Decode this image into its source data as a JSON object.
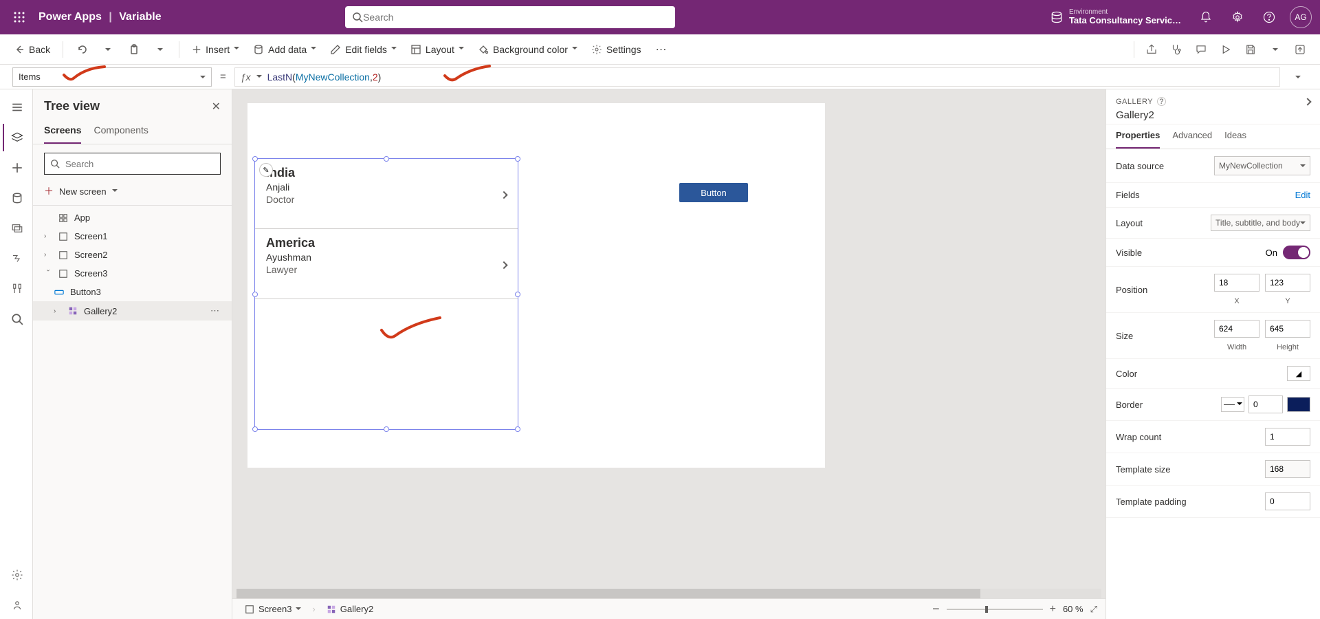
{
  "header": {
    "app_name": "Power Apps",
    "page_title": "Variable",
    "search_placeholder": "Search",
    "env_label": "Environment",
    "env_name": "Tata Consultancy Servic…",
    "avatar_initials": "AG"
  },
  "toolbar": {
    "back": "Back",
    "insert": "Insert",
    "add_data": "Add data",
    "edit_fields": "Edit fields",
    "layout": "Layout",
    "background_color": "Background color",
    "settings": "Settings"
  },
  "formula": {
    "property": "Items",
    "fn": "LastN",
    "arg1": "MyNewCollection",
    "arg2": "2"
  },
  "tree": {
    "title": "Tree view",
    "tab_screens": "Screens",
    "tab_components": "Components",
    "search_placeholder": "Search",
    "new_screen": "New screen",
    "nodes": {
      "app": "App",
      "screen1": "Screen1",
      "screen2": "Screen2",
      "screen3": "Screen3",
      "button3": "Button3",
      "gallery2": "Gallery2"
    }
  },
  "canvas": {
    "button_label": "Button",
    "gallery_items": [
      {
        "title": "India",
        "subtitle": "Anjali",
        "body": "Doctor"
      },
      {
        "title": "America",
        "subtitle": "Ayushman",
        "body": "Lawyer"
      }
    ]
  },
  "status": {
    "crumb_screen": "Screen3",
    "crumb_gallery": "Gallery2",
    "zoom": "60",
    "zoom_unit": "%"
  },
  "props": {
    "type": "GALLERY",
    "name": "Gallery2",
    "tab_properties": "Properties",
    "tab_advanced": "Advanced",
    "tab_ideas": "Ideas",
    "data_source_label": "Data source",
    "data_source_value": "MyNewCollection",
    "fields_label": "Fields",
    "fields_action": "Edit",
    "layout_label": "Layout",
    "layout_value": "Title, subtitle, and body",
    "visible_label": "Visible",
    "visible_value": "On",
    "position_label": "Position",
    "pos_x": "18",
    "pos_y": "123",
    "pos_xlabel": "X",
    "pos_ylabel": "Y",
    "size_label": "Size",
    "size_w": "624",
    "size_h": "645",
    "size_wlabel": "Width",
    "size_hlabel": "Height",
    "color_label": "Color",
    "border_label": "Border",
    "border_width": "0",
    "wrap_label": "Wrap count",
    "wrap_value": "1",
    "template_size_label": "Template size",
    "template_size_value": "168",
    "template_padding_label": "Template padding",
    "template_padding_value": "0"
  }
}
